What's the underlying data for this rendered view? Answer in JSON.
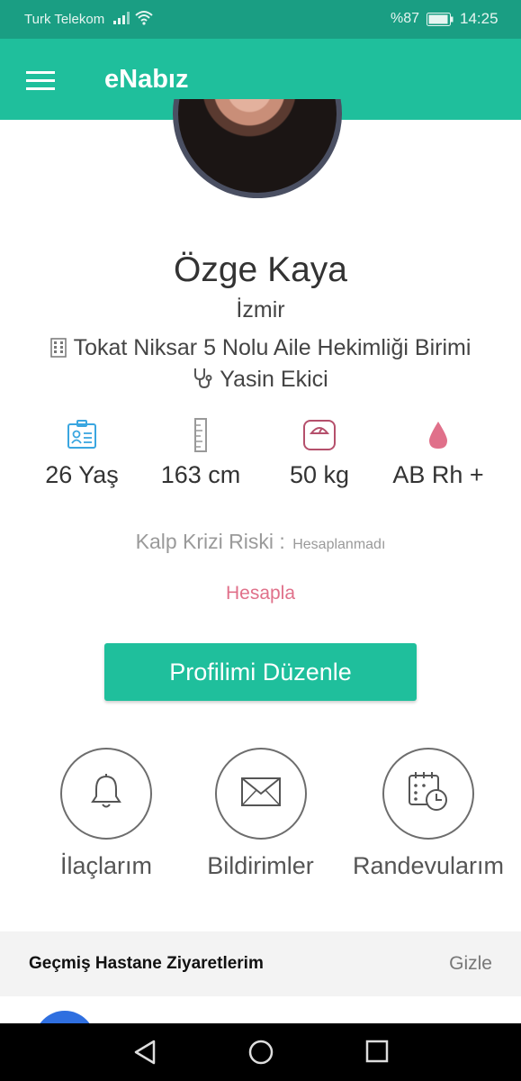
{
  "status_bar": {
    "carrier": "Turk Telekom",
    "battery": "%87",
    "time": "14:25"
  },
  "app_bar": {
    "title": "eNabız",
    "menu_icon": "hamburger-menu-icon"
  },
  "profile": {
    "name": "Özge Kaya",
    "city": "İzmir",
    "hospital": "Tokat Niksar 5 Nolu Aile Hekimliği Birimi",
    "doctor": "Yasin Ekici"
  },
  "stats": [
    {
      "icon": "id-card-icon",
      "value": "26 Yaş",
      "color": "#3aa6e0"
    },
    {
      "icon": "ruler-icon",
      "value": "163 cm",
      "color": "#999999"
    },
    {
      "icon": "scale-icon",
      "value": "50 kg",
      "color": "#b5506c"
    },
    {
      "icon": "blood-drop-icon",
      "value": "AB Rh +",
      "color": "#e0708a"
    }
  ],
  "risk": {
    "label": "Kalp Krizi Riski :",
    "value": "Hesaplanmadı"
  },
  "calculate_link": "Hesapla",
  "edit_button": "Profilimi Düzenle",
  "quick_actions": [
    {
      "icon": "bell-icon",
      "label": "İlaçlarım"
    },
    {
      "icon": "envelope-icon",
      "label": "Bildirimler"
    },
    {
      "icon": "calendar-clock-icon",
      "label": "Randevularım"
    }
  ],
  "visits_section": {
    "title": "Geçmiş Hastane Ziyaretlerim",
    "hide": "Gizle"
  },
  "colors": {
    "accent": "#1fbf9c",
    "status_bar": "#1a9e83",
    "link": "#e0708a"
  }
}
